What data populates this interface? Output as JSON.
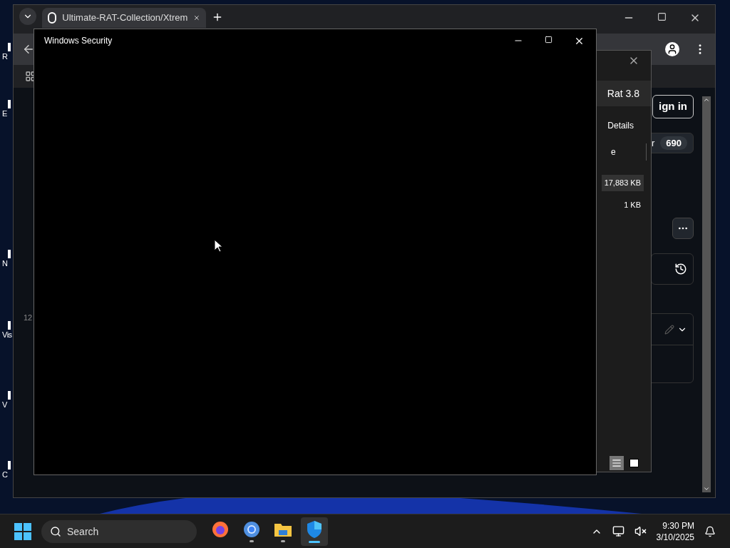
{
  "desktop": {
    "icons": [
      {
        "label": "R"
      },
      {
        "label": "E"
      },
      {
        "label": "N"
      },
      {
        "label": "Vis"
      },
      {
        "label": "V"
      },
      {
        "label": "C"
      }
    ]
  },
  "browser": {
    "tab": {
      "title": "Ultimate-RAT-Collection/Xtrem"
    },
    "sign_in": "ign in",
    "counter": {
      "label": "r",
      "count": "690"
    },
    "fragment": "12"
  },
  "download_panel": {
    "title": "Rat 3.8",
    "details": "Details",
    "column": "e",
    "rows": [
      {
        "size": "17,883 KB",
        "selected": true
      },
      {
        "size": "1 KB",
        "selected": false
      }
    ],
    "views": [
      {
        "kind": "list",
        "selected": true
      },
      {
        "kind": "tiles",
        "selected": false
      }
    ]
  },
  "security_window": {
    "title": "Windows Security"
  },
  "taskbar": {
    "search": {
      "placeholder": "Search"
    },
    "apps": [
      {
        "kind": "firefox",
        "running": false,
        "active": false
      },
      {
        "kind": "chrome",
        "running": true,
        "active": false
      },
      {
        "kind": "files",
        "running": true,
        "active": false
      },
      {
        "kind": "shield",
        "running": true,
        "active": true
      }
    ],
    "clock": {
      "time": "9:30 PM",
      "date": "3/10/2025"
    }
  }
}
